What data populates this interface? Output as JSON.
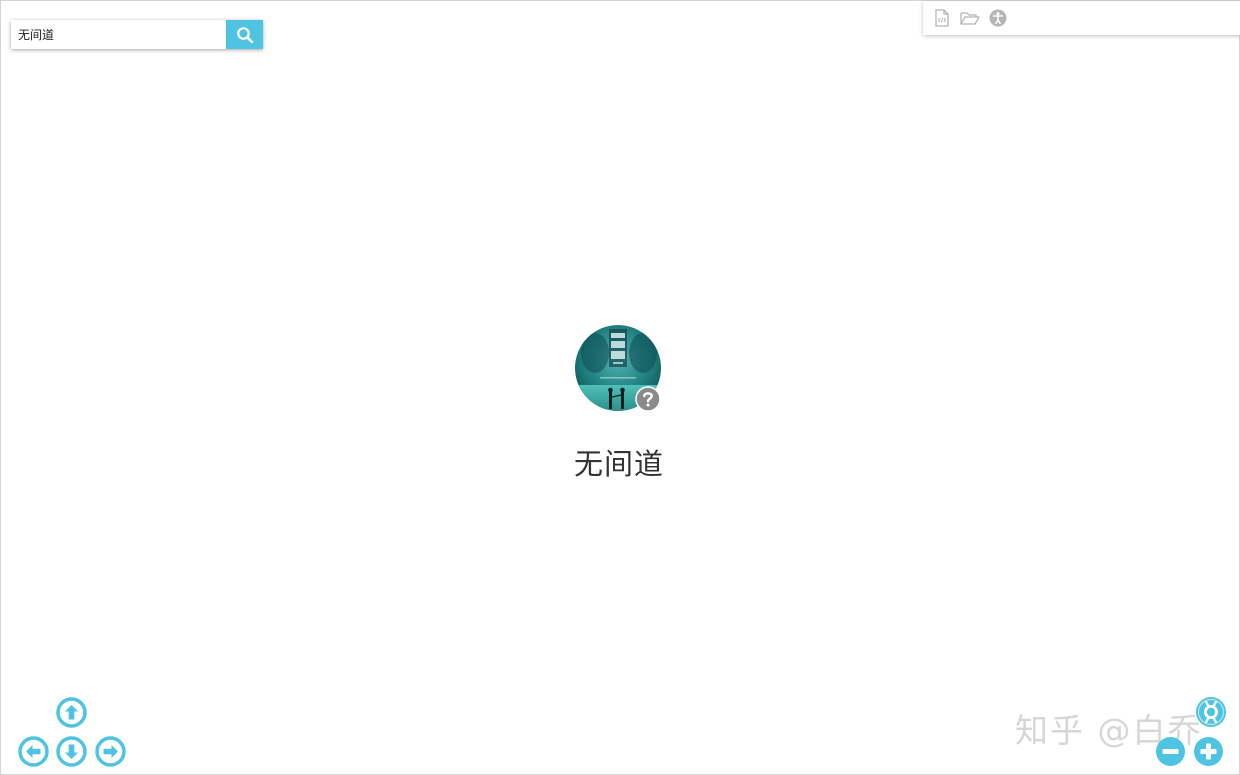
{
  "search": {
    "value": "无间道",
    "button_icon": "search-icon"
  },
  "toolbar": {
    "icons": [
      "file-code-icon",
      "folder-open-icon",
      "accessibility-icon"
    ]
  },
  "node": {
    "label": "无间道",
    "badge_icon": "question-icon"
  },
  "navigation": {
    "up": "arrow-up-icon",
    "left": "arrow-left-icon",
    "down": "arrow-down-icon",
    "right": "arrow-right-icon"
  },
  "zoom": {
    "out": "minus-icon",
    "in": "plus-icon",
    "help": "lifebuoy-icon"
  },
  "watermark": {
    "text": "知乎 @白乔"
  },
  "colors": {
    "accent": "#4fc3e2",
    "badge": "#8a8a8a",
    "toolbar_icon": "#b5b5b5"
  }
}
